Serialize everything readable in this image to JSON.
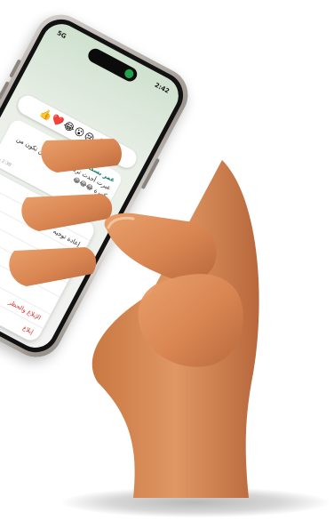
{
  "phone": {
    "status_time": "2:42",
    "status_network": "5G",
    "reaction_emojis": "👍❤️😂😮😢🙏+",
    "message": {
      "sender": "عمر بسكالة",
      "text": "عبرت أحدث ترنك بسرعة يمكن تكون من كبيرة 😂😂😂",
      "time": "2:38 م"
    },
    "menu": [
      {
        "label": "",
        "icon": "reply-icon",
        "danger": false
      },
      {
        "label": "إعادة توجيه",
        "icon": "forward-icon",
        "danger": false
      },
      {
        "label": "",
        "icon": "copy-icon",
        "danger": false
      },
      {
        "label": "",
        "icon": "info-icon",
        "danger": false
      },
      {
        "label": "",
        "icon": "star-icon",
        "danger": false
      },
      {
        "label": "",
        "icon": "delete-icon",
        "danger": true
      },
      {
        "label": "الإبلاغ والحظر",
        "icon": "block-icon",
        "danger": true
      },
      {
        "label": "إبلاغ",
        "icon": "report-icon",
        "danger": true
      }
    ]
  },
  "colors": {
    "skin": "#e0925f",
    "skin_shadow": "#b86a3f",
    "frame": "#9c958f",
    "accent_green": "#1fa34a",
    "danger": "#e0322e"
  }
}
